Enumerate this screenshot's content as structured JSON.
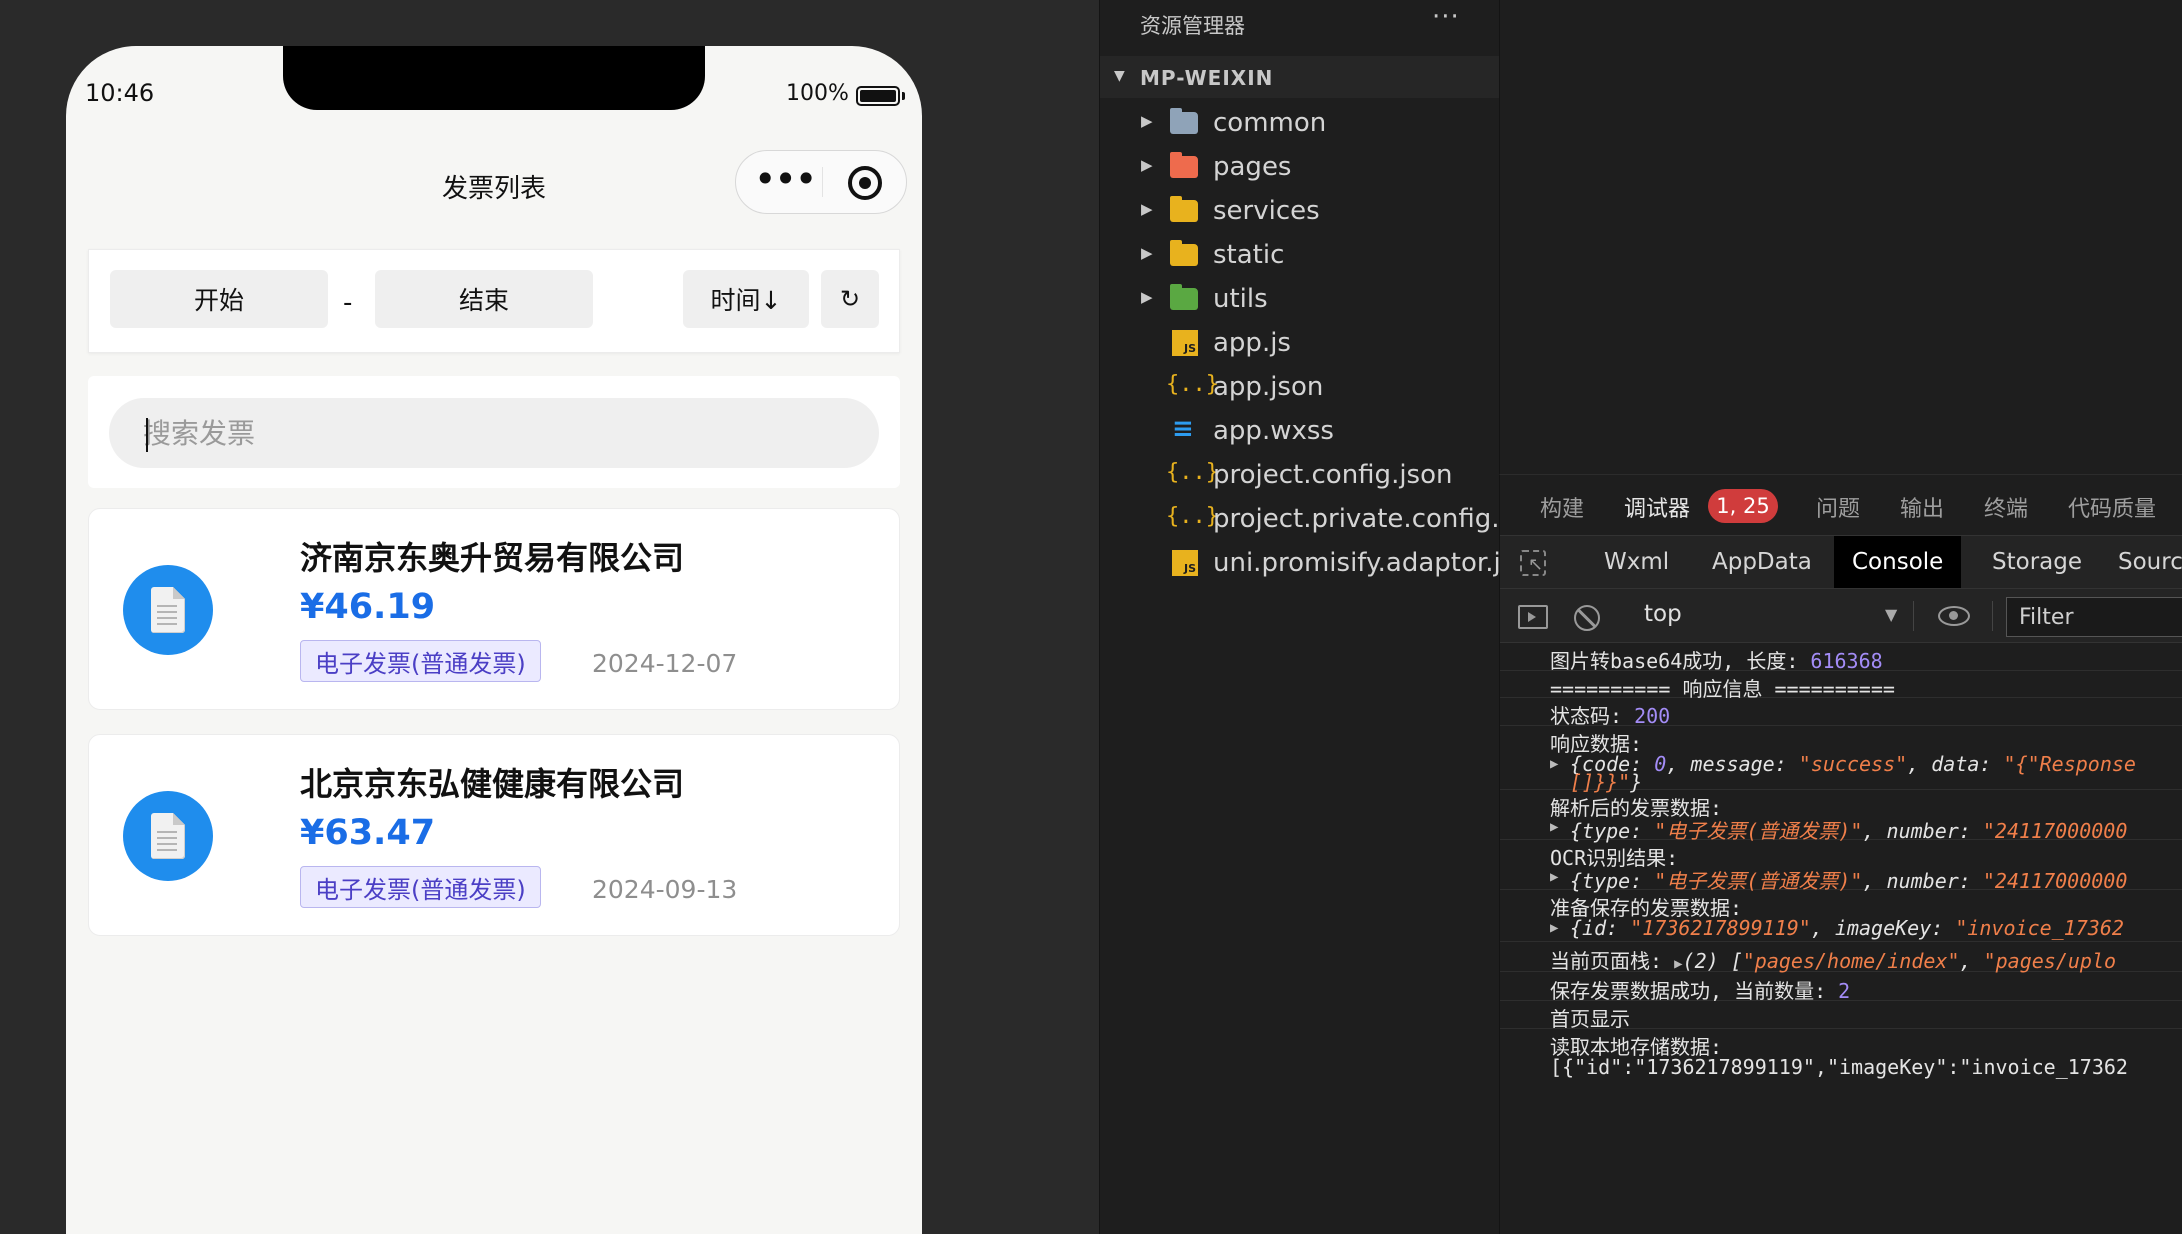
{
  "phone": {
    "status_time": "10:46",
    "battery_text": "100%",
    "nav_title": "发票列表",
    "filter": {
      "start_label": "开始",
      "dash": "-",
      "end_label": "结束",
      "sort_label": "时间↓",
      "reset_label": "↻"
    },
    "search_placeholder": "搜索发票",
    "invoices": [
      {
        "company": "济南京东奥升贸易有限公司",
        "amount": "¥46.19",
        "type": "电子发票(普通发票)",
        "date": "2024-12-07"
      },
      {
        "company": "北京京东弘健健康有限公司",
        "amount": "¥63.47",
        "type": "电子发票(普通发票)",
        "date": "2024-09-13"
      }
    ]
  },
  "explorer": {
    "title": "资源管理器",
    "more": "···",
    "root": "MP-WEIXIN",
    "items": [
      {
        "label": "common",
        "icon": "folder-icon",
        "color": "#8fa3b8"
      },
      {
        "label": "pages",
        "icon": "folder-icon",
        "color": "#ee6b4d"
      },
      {
        "label": "services",
        "icon": "folder-icon",
        "color": "#e8b21e"
      },
      {
        "label": "static",
        "icon": "folder-icon",
        "color": "#e8b21e"
      },
      {
        "label": "utils",
        "icon": "folder-icon",
        "color": "#5aa842"
      },
      {
        "label": "app.js",
        "icon": "js-file-icon"
      },
      {
        "label": "app.json",
        "icon": "json-file-icon"
      },
      {
        "label": "app.wxss",
        "icon": "css-file-icon"
      },
      {
        "label": "project.config.json",
        "icon": "json-file-icon"
      },
      {
        "label": "project.private.config...",
        "icon": "json-file-icon"
      },
      {
        "label": "uni.promisify.adaptor.js",
        "icon": "js-file-icon"
      }
    ]
  },
  "debugger": {
    "tabs": [
      "构建",
      "调试器",
      "问题",
      "输出",
      "终端",
      "代码质量"
    ],
    "active_tab": "调试器",
    "badge": "1, 25",
    "panel_tabs": [
      "Wxml",
      "AppData",
      "Console",
      "Storage",
      "Sourc"
    ],
    "active_panel": "Console",
    "context": "top",
    "filter_placeholder": "Filter",
    "logs": {
      "l1_text": "图片转base64成功, 长度: ",
      "l1_num": "616368",
      "l2": "========== 响应信息 ==========",
      "l3_text": "状态码: ",
      "l3_num": "200",
      "l4": "响应数据:",
      "l4_obj_a": "{code: ",
      "l4_obj_b": "0",
      "l4_obj_c": ", message: ",
      "l4_obj_d": "\"success\"",
      "l4_obj_e": ", data: ",
      "l4_obj_f": "\"{\"Response",
      "l4_obj2": "[]}}\"",
      "l4_obj2_end": "}",
      "l5": "解析后的发票数据:",
      "l5_obj_a": "{type: ",
      "l5_obj_b": "\"电子发票(普通发票)\"",
      "l5_obj_c": ", number: ",
      "l5_obj_d": "\"24117000000",
      "l6": "OCR识别结果:",
      "l6_obj_a": "{type: ",
      "l6_obj_b": "\"电子发票(普通发票)\"",
      "l6_obj_c": ", number: ",
      "l6_obj_d": "\"24117000000",
      "l7": "准备保存的发票数据:",
      "l7_obj_a": "{id: ",
      "l7_obj_b": "\"1736217899119\"",
      "l7_obj_c": ", imageKey: ",
      "l7_obj_d": "\"invoice_17362",
      "l8_a": "当前页面栈: ",
      "l8_b": "(2) [",
      "l8_c": "\"pages/home/index\"",
      "l8_d": ", ",
      "l8_e": "\"pages/uplo",
      "l9_text": "保存发票数据成功, 当前数量: ",
      "l9_num": "2",
      "l10": "首页显示",
      "l11": "读取本地存储数据:",
      "l11_b": "[{\"id\":\"1736217899119\",\"imageKey\":\"invoice_17362"
    }
  }
}
